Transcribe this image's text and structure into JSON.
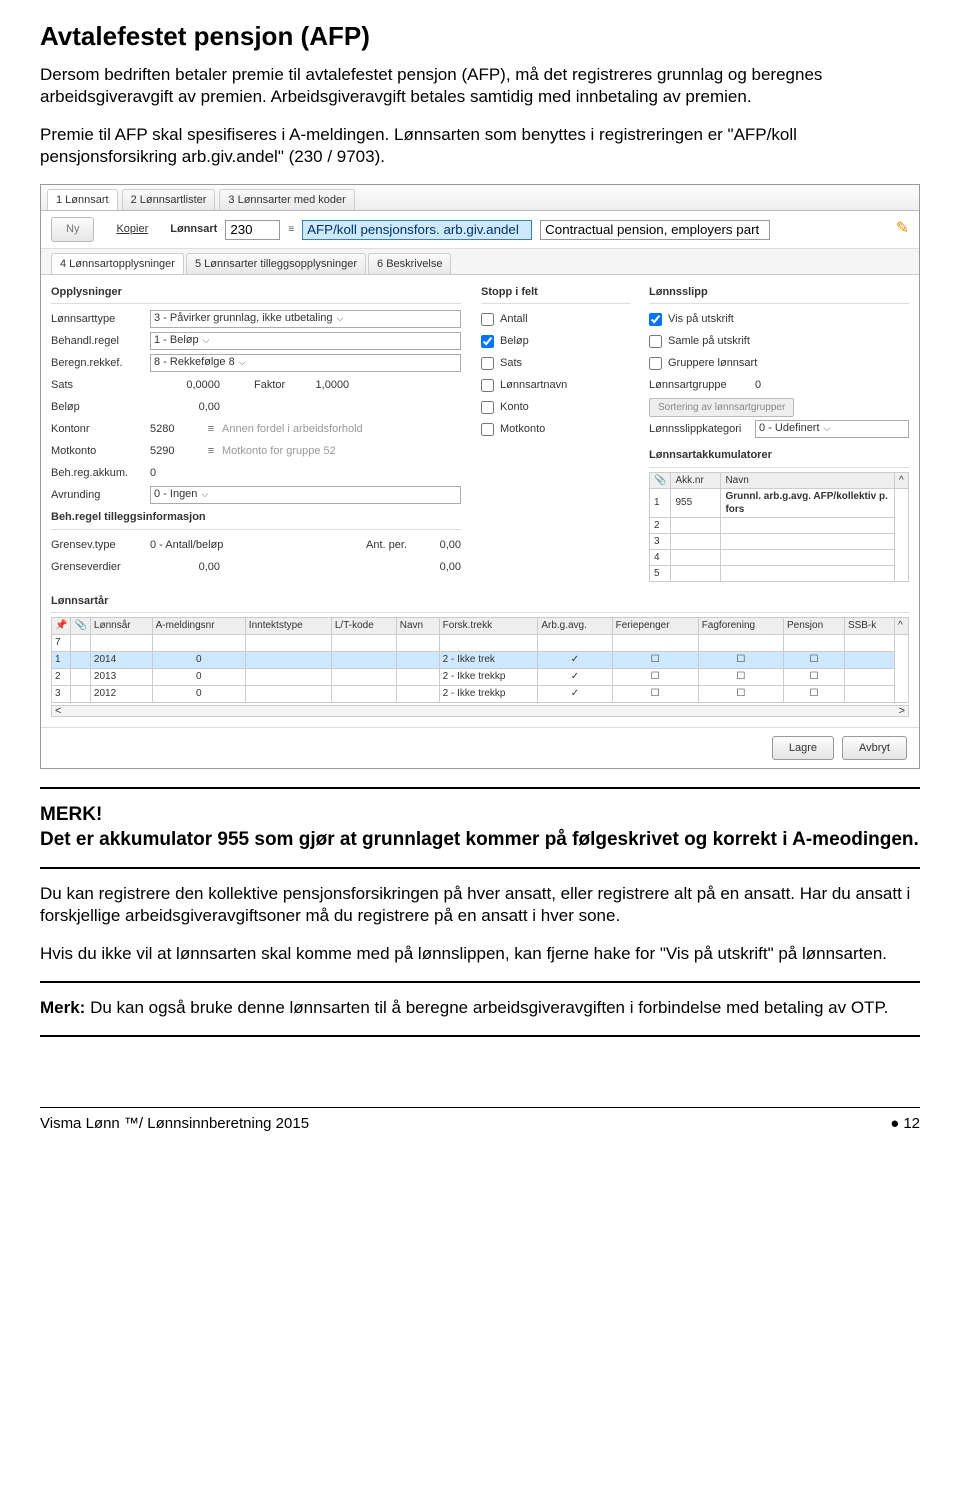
{
  "heading": "Avtalefestet pensjon (AFP)",
  "para1": "Dersom bedriften betaler premie til avtalefestet pensjon (AFP), må det registreres grunnlag og beregnes arbeidsgiveravgift av premien. Arbeidsgiveravgift betales samtidig med innbetaling av premien.",
  "para2": "Premie til AFP skal spesifiseres i A-meldingen. Lønnsarten som benyttes i registreringen er \"AFP/koll pensjonsforsikring arb.giv.andel\" (230 / 9703).",
  "ui": {
    "tabs": [
      "1 Lønnsart",
      "2 Lønnsartlister",
      "3 Lønnsarter med koder"
    ],
    "toolbar": {
      "ny": "Ny",
      "kopier": "Kopier",
      "lonnsart": "Lønnsart",
      "code": "230",
      "name": "AFP/koll pensjonsfors. arb.giv.andel",
      "desc": "Contractual pension, employers part"
    },
    "subtabs": [
      "4 Lønnsartopplysninger",
      "5 Lønnsarter tilleggsopplysninger",
      "6 Beskrivelse"
    ],
    "sections": {
      "opplysninger": "Opplysninger",
      "stopp": "Stopp i felt",
      "lonnsslipp": "Lønnsslipp",
      "tillegg": "Beh.regel tilleggsinformasjon",
      "akkum_h": "Lønnsartakkumulatorer",
      "lonnsartar": "Lønnsartår"
    },
    "fields": {
      "lonnsarttype": {
        "lbl": "Lønnsarttype",
        "val": "3 - Påvirker grunnlag, ikke utbetaling"
      },
      "behandlregel": {
        "lbl": "Behandl.regel",
        "val": "1 - Beløp"
      },
      "beregnrekkef": {
        "lbl": "Beregn.rekkef.",
        "val": "8 - Rekkefølge 8"
      },
      "sats": {
        "lbl": "Sats",
        "val": "0,0000",
        "faktor_lbl": "Faktor",
        "faktor_val": "1,0000"
      },
      "belop": {
        "lbl": "Beløp",
        "val": "0,00"
      },
      "kontonr": {
        "lbl": "Kontonr",
        "val": "5280",
        "note": "Annen fordel i arbeidsforhold"
      },
      "motkonto": {
        "lbl": "Motkonto",
        "val": "5290",
        "note": "Motkonto for gruppe 52"
      },
      "behregakkum": {
        "lbl": "Beh.reg.akkum.",
        "val": "0"
      },
      "avrunding": {
        "lbl": "Avrunding",
        "val": "0 - Ingen"
      },
      "grensevtype": {
        "lbl": "Grensev.type",
        "val": "0 - Antall/beløp",
        "antper_lbl": "Ant. per.",
        "antper_val": "0,00"
      },
      "grenseverdier": {
        "lbl": "Grenseverdier",
        "val1": "0,00",
        "val2": "0,00"
      }
    },
    "stopp": {
      "antall": "Antall",
      "belop": "Beløp",
      "sats": "Sats",
      "lonnsartnavn": "Lønnsartnavn",
      "konto": "Konto",
      "motkonto": "Motkonto"
    },
    "slipp": {
      "vis": "Vis på utskrift",
      "samle": "Samle på utskrift",
      "gruppere": "Gruppere lønnsart",
      "gruppe_lbl": "Lønnsartgruppe",
      "gruppe_val": "0",
      "sort_btn": "Sortering av lønnsartgrupper",
      "kategori_lbl": "Lønnsslippkategori",
      "kategori_val": "0 - Udefinert"
    },
    "akkum": {
      "cols": [
        "",
        "Akk.nr",
        "Navn"
      ],
      "rows": [
        {
          "idx": "1",
          "nr": "955",
          "navn": "Grunnl. arb.g.avg. AFP/kollektiv p. fors"
        },
        {
          "idx": "2",
          "nr": "",
          "navn": ""
        },
        {
          "idx": "3",
          "nr": "",
          "navn": ""
        },
        {
          "idx": "4",
          "nr": "",
          "navn": ""
        },
        {
          "idx": "5",
          "nr": "",
          "navn": ""
        }
      ]
    },
    "yrtable": {
      "cols": [
        "",
        "",
        "Lønnsår",
        "A-meldingsnr",
        "Inntektstype",
        "L/T-kode",
        "Navn",
        "Forsk.trekk",
        "Arb.g.avg.",
        "Feriepenger",
        "Fagforening",
        "Pensjon",
        "SSB-k"
      ],
      "rows": [
        {
          "idx": "7",
          "year": "",
          "ameld": "",
          "fors": "",
          "arbgavg": ""
        },
        {
          "idx": "1",
          "year": "2014",
          "ameld": "0",
          "fors": "2 - Ikke trek",
          "arbgavg": "✓"
        },
        {
          "idx": "2",
          "year": "2013",
          "ameld": "0",
          "fors": "2 - Ikke trekkp",
          "arbgavg": "✓"
        },
        {
          "idx": "3",
          "year": "2012",
          "ameld": "0",
          "fors": "2 - Ikke trekkp",
          "arbgavg": "✓"
        }
      ]
    },
    "buttons": {
      "lagre": "Lagre",
      "avbryt": "Avbryt"
    }
  },
  "merk": "MERK!",
  "merk_text": "Det er akkumulator 955 som gjør at grunnlaget kommer på følgeskrivet og korrekt i A-meodingen.",
  "para3": "Du kan registrere den kollektive pensjonsforsikringen på hver ansatt, eller registrere alt på en ansatt. Har du ansatt i forskjellige arbeidsgiveravgiftsoner må du registrere på en ansatt i hver sone.",
  "para4": "Hvis du ikke vil at lønnsarten skal komme med på lønnslippen, kan fjerne hake for \"Vis på utskrift\" på lønnsarten.",
  "merk2_prefix": "Merk:",
  "merk2_text": " Du kan også bruke denne lønnsarten til å beregne arbeidsgiveravgiften i forbindelse med betaling av OTP.",
  "footer": {
    "left": "Visma Lønn ™/ Lønnsinnberetning 2015",
    "right": "12"
  }
}
